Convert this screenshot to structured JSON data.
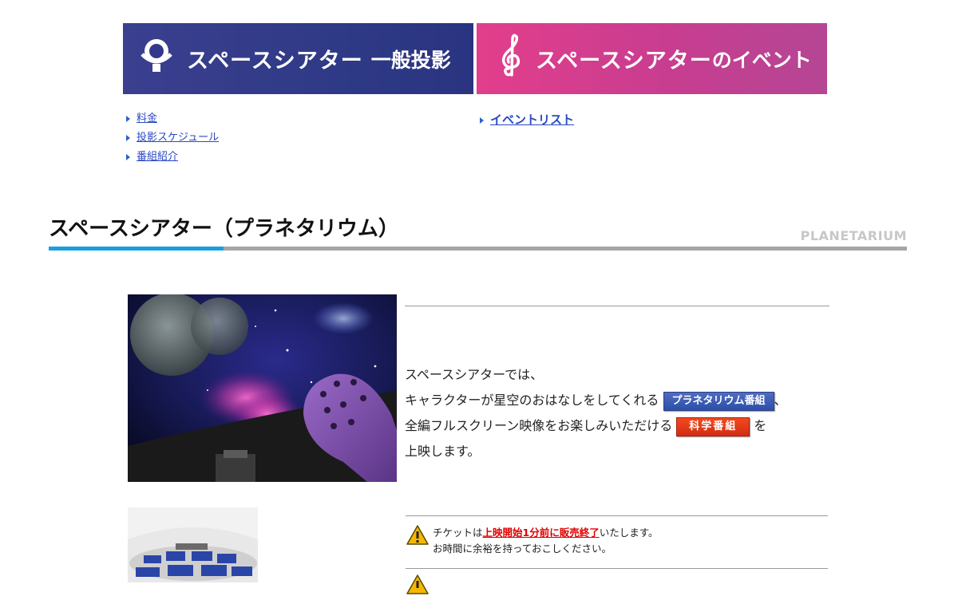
{
  "banners": {
    "general": {
      "title": "スペースシアター",
      "subtitle": "一般投影",
      "icon": "planetarium-projector-icon"
    },
    "event": {
      "title": "スペースシアター",
      "subtitle": "のイベント",
      "icon": "treble-clef-icon"
    }
  },
  "links_left": [
    "料金",
    "投影スケジュール",
    "番組紹介"
  ],
  "links_right": [
    "イベントリスト"
  ],
  "section": {
    "title": "スペースシアター（プラネタリウム）",
    "title_en": "PLANETARIUM"
  },
  "intro": {
    "line1": "スペースシアターでは、",
    "line2": "キャラクターが星空のおはなしをしてくれる",
    "badge1": "プラネタリウム番組",
    "sep": "、",
    "line3": "全編フルスクリーン映像をお楽しみいただける",
    "badge2": "科学番組",
    "particle": "を",
    "line4": "上映します。"
  },
  "notice": {
    "pre": "チケットは",
    "strong": "上映開始1分前に販売終了",
    "post": "いたします。",
    "line2": "お時間に余裕を持っておこしください。"
  },
  "colors": {
    "accent_blue": "#1a9fdc",
    "badge_blue": "#2d4fa8",
    "badge_red": "#d52c12",
    "banner_purple": "#2f3a86",
    "banner_pink": "#d93d8d"
  }
}
